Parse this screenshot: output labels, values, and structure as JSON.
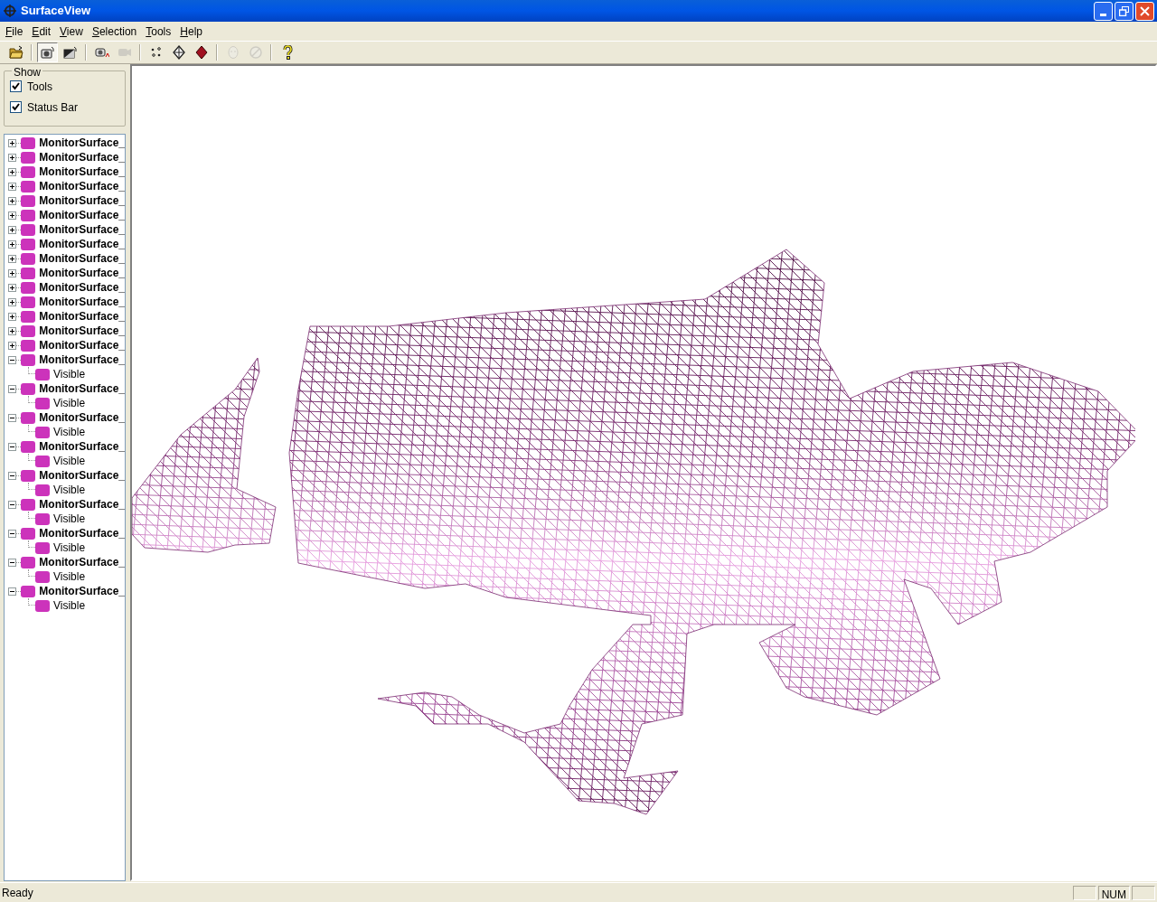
{
  "window": {
    "title": "SurfaceView"
  },
  "menu": [
    "File",
    "Edit",
    "View",
    "Selection",
    "Tools",
    "Help"
  ],
  "toolbar": [
    {
      "pressed": false,
      "disabled": false
    },
    {
      "pressed": true,
      "disabled": false
    },
    {
      "pressed": false,
      "disabled": false
    },
    {
      "pressed": false,
      "disabled": false
    },
    {
      "pressed": false,
      "disabled": true
    },
    {
      "pressed": false,
      "disabled": false
    },
    {
      "pressed": false,
      "disabled": false
    },
    {
      "pressed": false,
      "disabled": false
    },
    {
      "pressed": false,
      "disabled": true
    },
    {
      "pressed": false,
      "disabled": true
    },
    {
      "pressed": false,
      "disabled": false
    }
  ],
  "show_group": {
    "title": "Show",
    "options": [
      {
        "label": "Tools",
        "checked": true
      },
      {
        "label": "Status Bar",
        "checked": true
      }
    ]
  },
  "tree": [
    {
      "label": "MonitorSurface_",
      "expanded": false
    },
    {
      "label": "MonitorSurface_",
      "expanded": false
    },
    {
      "label": "MonitorSurface_",
      "expanded": false
    },
    {
      "label": "MonitorSurface_",
      "expanded": false
    },
    {
      "label": "MonitorSurface_",
      "expanded": false
    },
    {
      "label": "MonitorSurface_",
      "expanded": false
    },
    {
      "label": "MonitorSurface_",
      "expanded": false
    },
    {
      "label": "MonitorSurface_",
      "expanded": false
    },
    {
      "label": "MonitorSurface_",
      "expanded": false
    },
    {
      "label": "MonitorSurface_",
      "expanded": false
    },
    {
      "label": "MonitorSurface_",
      "expanded": false
    },
    {
      "label": "MonitorSurface_",
      "expanded": false
    },
    {
      "label": "MonitorSurface_",
      "expanded": false
    },
    {
      "label": "MonitorSurface_",
      "expanded": false
    },
    {
      "label": "MonitorSurface_",
      "expanded": false
    },
    {
      "label": "MonitorSurface_",
      "expanded": true,
      "children": [
        {
          "label": "Visible"
        }
      ]
    },
    {
      "label": "MonitorSurface_",
      "expanded": true,
      "children": [
        {
          "label": "Visible"
        }
      ]
    },
    {
      "label": "MonitorSurface_",
      "expanded": true,
      "children": [
        {
          "label": "Visible"
        }
      ]
    },
    {
      "label": "MonitorSurface_",
      "expanded": true,
      "children": [
        {
          "label": "Visible"
        }
      ]
    },
    {
      "label": "MonitorSurface_",
      "expanded": true,
      "children": [
        {
          "label": "Visible"
        }
      ]
    },
    {
      "label": "MonitorSurface_",
      "expanded": true,
      "children": [
        {
          "label": "Visible"
        }
      ]
    },
    {
      "label": "MonitorSurface_",
      "expanded": true,
      "children": [
        {
          "label": "Visible"
        }
      ]
    },
    {
      "label": "MonitorSurface_",
      "expanded": true,
      "children": [
        {
          "label": "Visible"
        }
      ]
    },
    {
      "label": "MonitorSurface_",
      "expanded": true,
      "children": [
        {
          "label": "Visible"
        }
      ]
    }
  ],
  "status_bar": {
    "text": "Ready",
    "indicators": [
      "NUM"
    ]
  }
}
